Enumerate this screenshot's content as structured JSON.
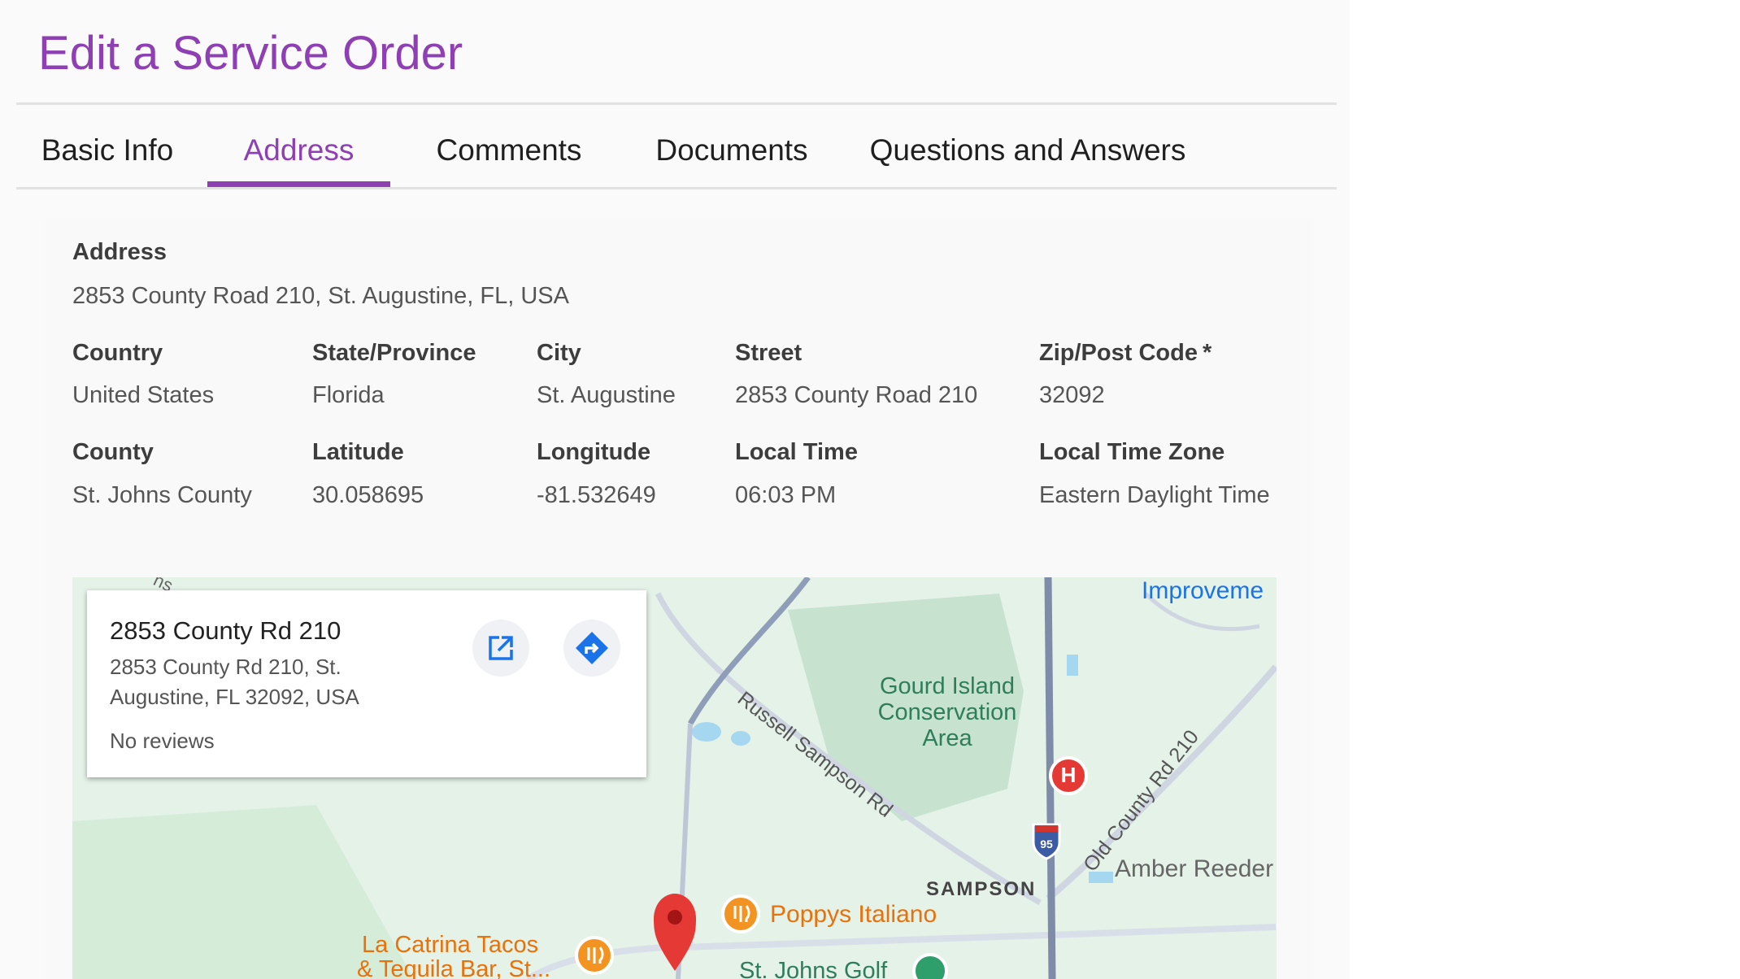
{
  "page": {
    "title": "Edit a Service Order"
  },
  "tabs": [
    {
      "label": "Basic Info"
    },
    {
      "label": "Address",
      "active": true
    },
    {
      "label": "Comments"
    },
    {
      "label": "Documents"
    },
    {
      "label": "Questions and Answers"
    }
  ],
  "address": {
    "label": "Address",
    "value": "2853 County Road 210, St. Augustine, FL, USA"
  },
  "fields": {
    "country": {
      "label": "Country",
      "value": "United States"
    },
    "state": {
      "label": "State/Province",
      "value": "Florida"
    },
    "city": {
      "label": "City",
      "value": "St. Augustine"
    },
    "street": {
      "label": "Street",
      "value": "2853 County Road 210"
    },
    "zip": {
      "label": "Zip/Post Code",
      "required_mark": "*",
      "value": "32092"
    },
    "county": {
      "label": "County",
      "value": "St. Johns County"
    },
    "latitude": {
      "label": "Latitude",
      "value": "30.058695"
    },
    "longitude": {
      "label": "Longitude",
      "value": "-81.532649"
    },
    "local_time": {
      "label": "Local Time",
      "value": "06:03 PM"
    },
    "local_time_zone": {
      "label": "Local Time Zone",
      "value": "Eastern Daylight Time"
    }
  },
  "map": {
    "popup": {
      "title": "2853 County Rd 210",
      "address_line1": "2853 County Rd 210, St.",
      "address_line2": "Augustine, FL 32092, USA",
      "reviews": "No reviews",
      "open_icon": "open-in-new-icon",
      "directions_icon": "directions-icon"
    },
    "labels": {
      "improvement": "Improveme",
      "russell": "Russell Sampson Rd",
      "gourd1": "Gourd Island",
      "gourd2": "Conservation",
      "gourd3": "Area",
      "old_county": "Old County Rd 210",
      "amber": "Amber Reeder",
      "sampson": "SAMPSON",
      "poppys": "Poppys Italiano",
      "catrina1": "La Catrina Tacos",
      "catrina2": "& Tequila Bar, St...",
      "st_johns": "St. Johns Golf",
      "highway": "95",
      "hospital": "H",
      "corner": "ns"
    },
    "colors": {
      "land": "#e4f2e8",
      "road": "#8f9db9",
      "highway": "#7f8ca9",
      "water": "#a6d7f0",
      "park": "#c7e3cf",
      "pin": "#e53935",
      "restaurant": "#f39322",
      "label_blue": "#1a73e8",
      "label_orange": "#e8710a",
      "label_green": "#2e7d5b"
    }
  }
}
